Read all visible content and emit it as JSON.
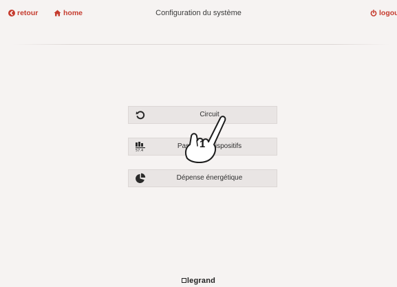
{
  "header": {
    "back_label": "retour",
    "home_label": "home",
    "title": "Configuration du système",
    "logout_label": "logout"
  },
  "menu": {
    "items": [
      {
        "label": "Circuit",
        "icon": "refresh-arrow-icon"
      },
      {
        "label": "Passerelle dispositifs",
        "icon": "meter-display-icon"
      },
      {
        "label": "Dépense énergétique",
        "icon": "pie-chart-icon"
      }
    ]
  },
  "overlay": {
    "callout_number": "1",
    "icon": "hand-pointer-icon"
  },
  "footer": {
    "brand": "legrand"
  },
  "colors": {
    "accent": "#c53b2e",
    "background": "#f6f3f2",
    "button_bg": "#e9e5e4"
  }
}
